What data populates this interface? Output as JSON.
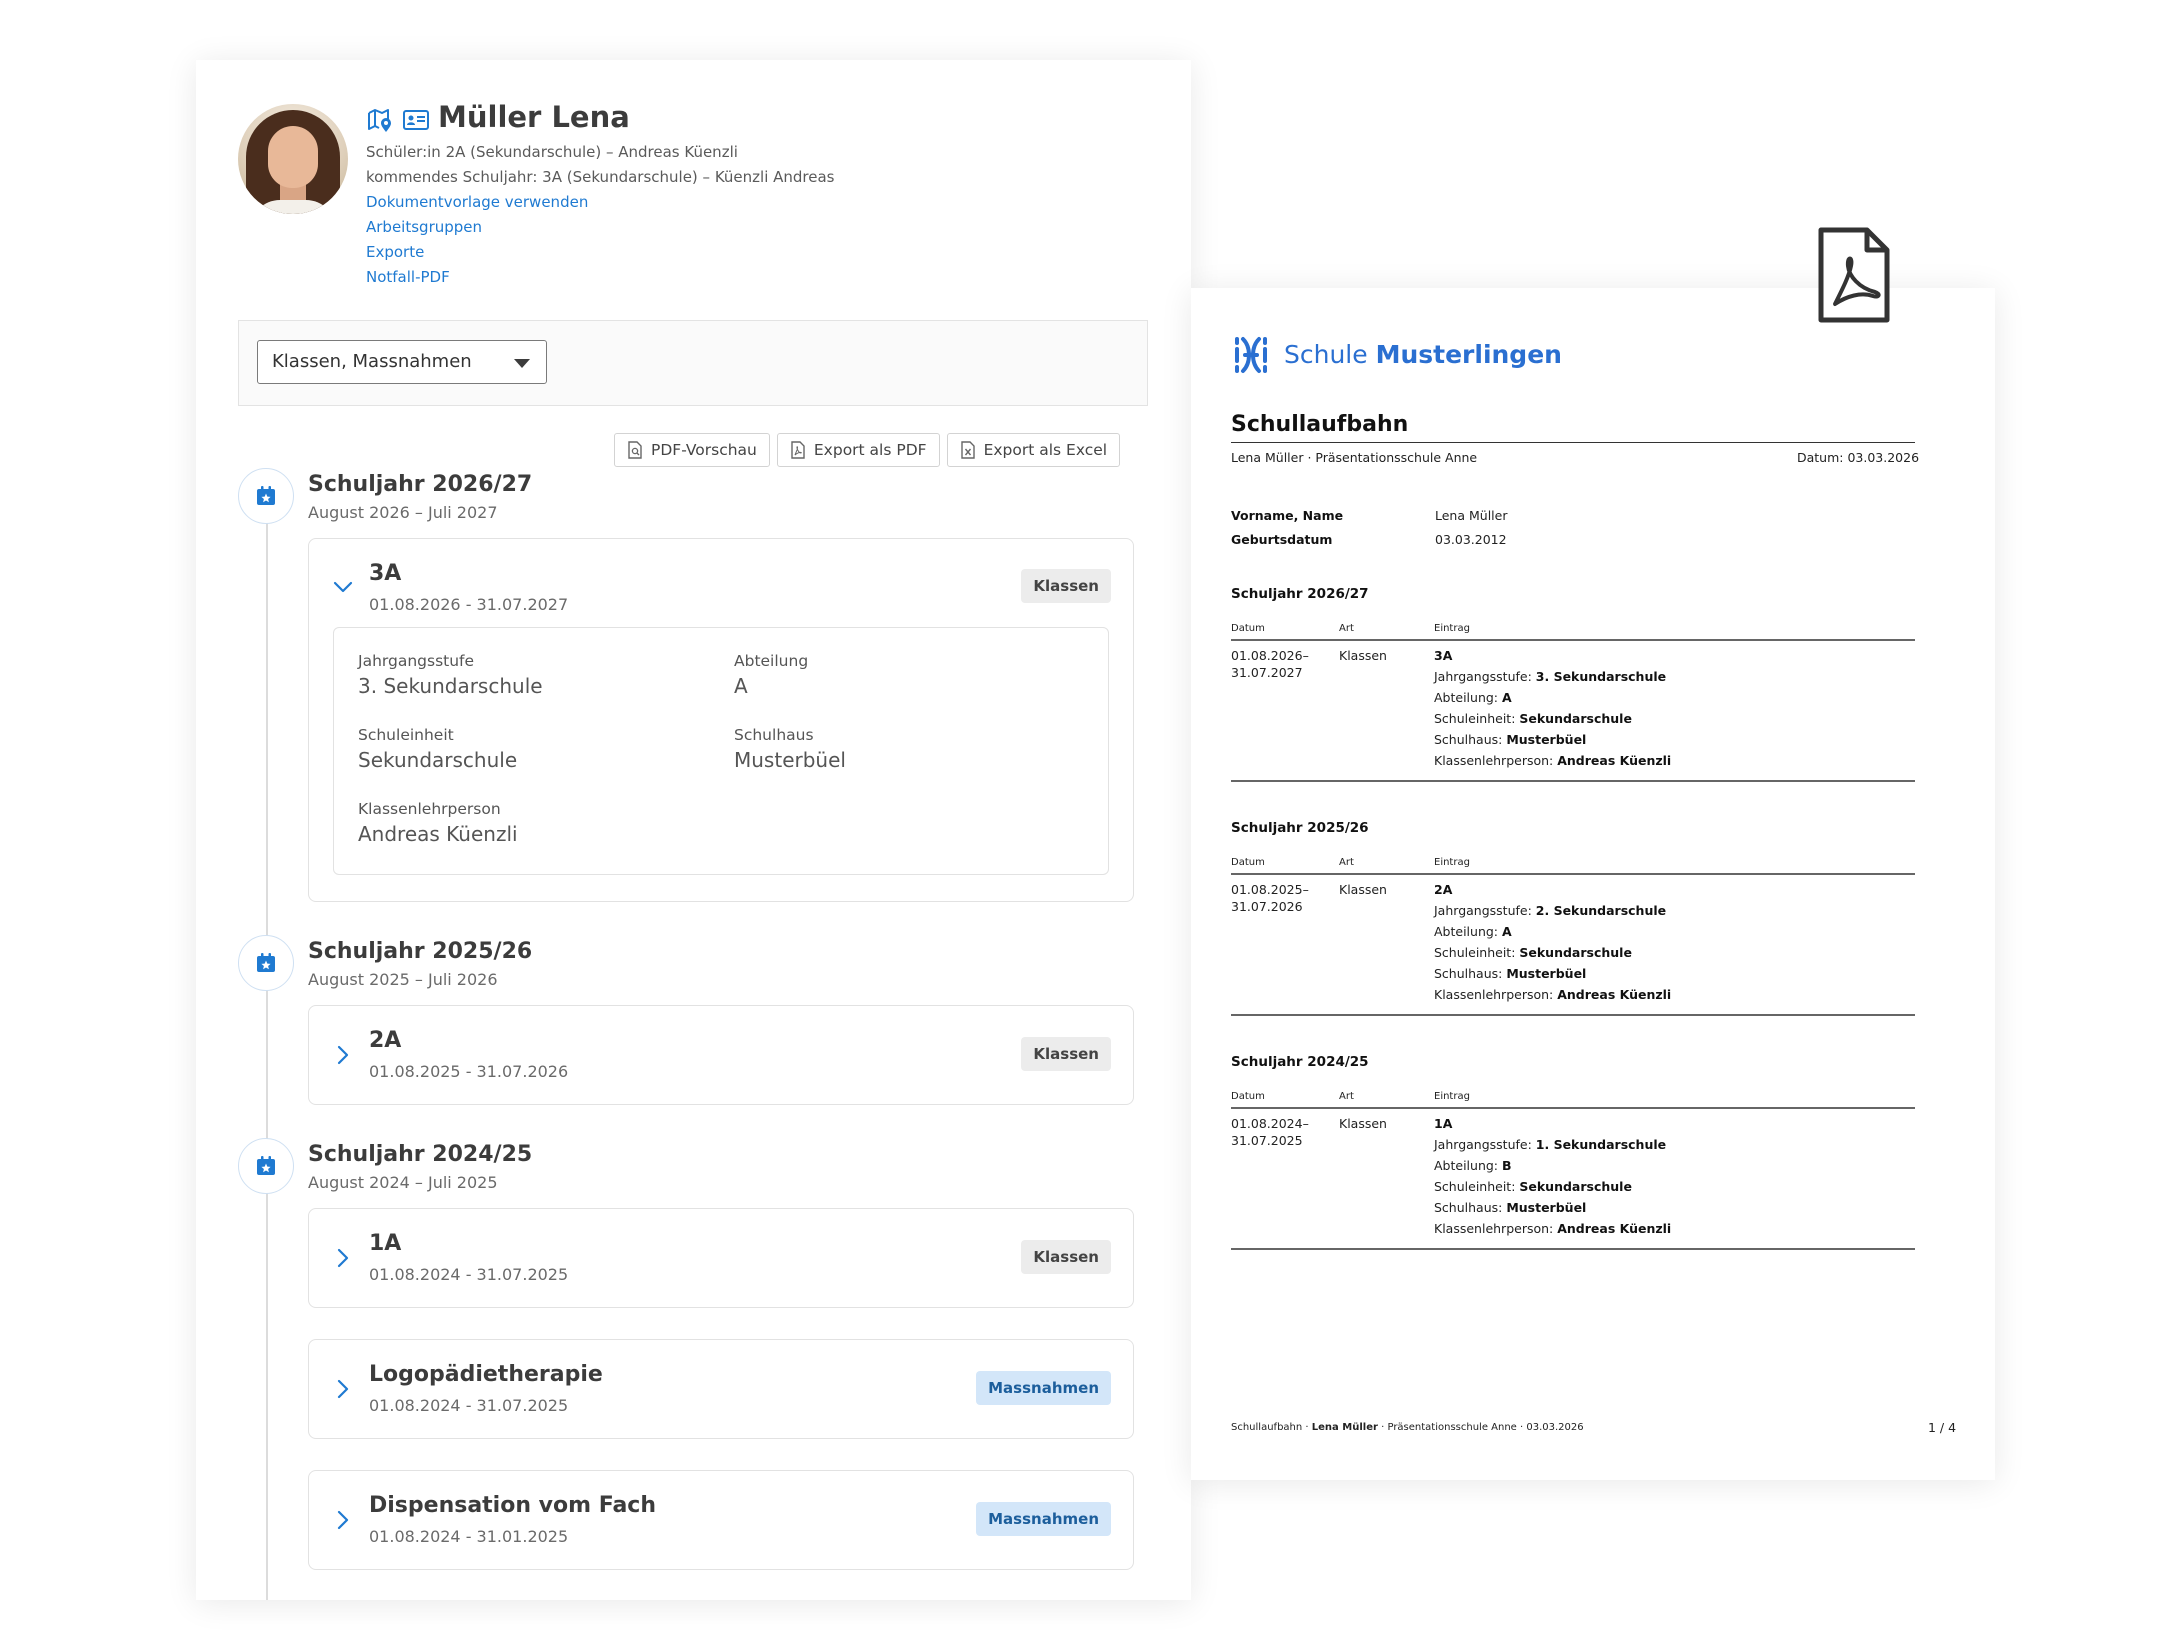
{
  "profile": {
    "name": "Müller Lena",
    "line1": "Schüler:in 2A (Sekundarschule) – Andreas Küenzli",
    "line2": "kommendes Schuljahr: 3A (Sekundarschule) – Küenzli Andreas",
    "links": [
      "Dokumentvorlage verwenden",
      "Arbeitsgruppen",
      "Exporte",
      "Notfall-PDF"
    ]
  },
  "filter": {
    "selected": "Klassen, Massnahmen"
  },
  "toolbar": {
    "pdf_preview": "PDF-Vorschau",
    "export_pdf": "Export als PDF",
    "export_excel": "Export als Excel"
  },
  "timeline": [
    {
      "title": "Schuljahr 2026/27",
      "range": "August 2026 – Juli 2027",
      "cards": [
        {
          "title": "3A",
          "dates": "01.08.2026 - 31.07.2027",
          "badge": "Klassen",
          "details": {
            "jahrgangsstufe_label": "Jahrgangsstufe",
            "jahrgangsstufe": "3. Sekundarschule",
            "abteilung_label": "Abteilung",
            "abteilung": "A",
            "schuleinheit_label": "Schuleinheit",
            "schuleinheit": "Sekundarschule",
            "schulhaus_label": "Schulhaus",
            "schulhaus": "Musterbüel",
            "klp_label": "Klassenlehrperson",
            "klp": "Andreas Küenzli"
          }
        }
      ]
    },
    {
      "title": "Schuljahr 2025/26",
      "range": "August 2025 – Juli 2026",
      "cards": [
        {
          "title": "2A",
          "dates": "01.08.2025 - 31.07.2026",
          "badge": "Klassen"
        }
      ]
    },
    {
      "title": "Schuljahr 2024/25",
      "range": "August 2024 – Juli 2025",
      "cards": [
        {
          "title": "1A",
          "dates": "01.08.2024 - 31.07.2025",
          "badge": "Klassen"
        },
        {
          "title": "Logopädietherapie",
          "dates": "01.08.2024 - 31.07.2025",
          "badge": "Massnahmen"
        },
        {
          "title": "Dispensation vom Fach",
          "dates": "01.08.2024 - 31.01.2025",
          "badge": "Massnahmen"
        }
      ]
    }
  ],
  "pdf": {
    "logo_light": "Schule ",
    "logo_bold": "Musterlingen",
    "title": "Schullaufbahn",
    "subheader_left": "Lena Müller · Präsentationsschule Anne",
    "subheader_right": "Datum: 03.03.2026",
    "name_label": "Vorname, Name",
    "name_value": "Lena Müller",
    "birth_label": "Geburtsdatum",
    "birth_value": "03.03.2012",
    "col_datum": "Datum",
    "col_art": "Art",
    "col_eintrag": "Eintrag",
    "sections": [
      {
        "year": "Schuljahr 2026/27",
        "date1": "01.08.2026–",
        "date2": "31.07.2027",
        "art": "Klassen",
        "klasse": "3A",
        "lines": [
          {
            "label": "Jahrgangsstufe: ",
            "value": "3. Sekundarschule"
          },
          {
            "label": "Abteilung: ",
            "value": "A"
          },
          {
            "label": "Schuleinheit: ",
            "value": "Sekundarschule"
          },
          {
            "label": "Schulhaus: ",
            "value": "Musterbüel"
          },
          {
            "label": "Klassenlehrperson: ",
            "value": "Andreas Küenzli"
          }
        ]
      },
      {
        "year": "Schuljahr 2025/26",
        "date1": "01.08.2025–",
        "date2": "31.07.2026",
        "art": "Klassen",
        "klasse": "2A",
        "lines": [
          {
            "label": "Jahrgangsstufe: ",
            "value": "2. Sekundarschule"
          },
          {
            "label": "Abteilung: ",
            "value": "A"
          },
          {
            "label": "Schuleinheit: ",
            "value": "Sekundarschule"
          },
          {
            "label": "Schulhaus: ",
            "value": "Musterbüel"
          },
          {
            "label": "Klassenlehrperson: ",
            "value": "Andreas Küenzli"
          }
        ]
      },
      {
        "year": "Schuljahr 2024/25",
        "date1": "01.08.2024–",
        "date2": "31.07.2025",
        "art": "Klassen",
        "klasse": "1A",
        "lines": [
          {
            "label": "Jahrgangsstufe: ",
            "value": "1. Sekundarschule"
          },
          {
            "label": "Abteilung: ",
            "value": "B"
          },
          {
            "label": "Schuleinheit: ",
            "value": "Sekundarschule"
          },
          {
            "label": "Schulhaus: ",
            "value": "Musterbüel"
          },
          {
            "label": "Klassenlehrperson: ",
            "value": "Andreas Küenzli"
          }
        ]
      }
    ],
    "footer_a": "Schullaufbahn · ",
    "footer_b": "Lena Müller",
    "footer_c": " · Präsentationsschule Anne · 03.03.2026",
    "page": "1 / 4"
  }
}
